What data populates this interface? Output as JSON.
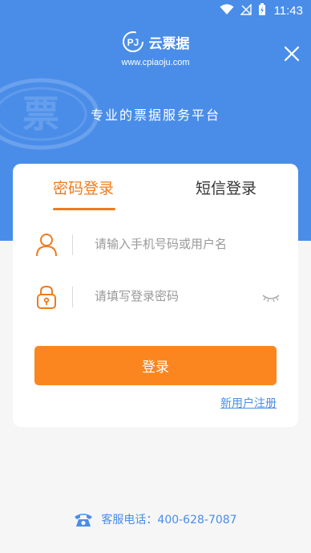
{
  "status_bar": {
    "time": "11:43"
  },
  "brand": {
    "name": "云票据",
    "url": "www.cpiaoju.com"
  },
  "slogan": "专业的票据服务平台",
  "watermark_char": "票",
  "tabs": [
    {
      "label": "密码登录",
      "active": true
    },
    {
      "label": "短信登录",
      "active": false
    }
  ],
  "form": {
    "username_placeholder": "请输入手机号码或用户名",
    "password_placeholder": "请填写登录密码",
    "login_label": "登录",
    "register_label": "新用户注册"
  },
  "service": {
    "label": "客服电话：400-628-7087"
  },
  "colors": {
    "primary_blue": "#4a8de9",
    "accent_orange": "#fb861f",
    "background": "#f6f6f6"
  },
  "icons": [
    "wifi-icon",
    "signal-icon",
    "battery-icon",
    "logo-icon",
    "close-icon",
    "user-icon",
    "lock-icon",
    "eye-closed-icon",
    "phone-icon"
  ]
}
